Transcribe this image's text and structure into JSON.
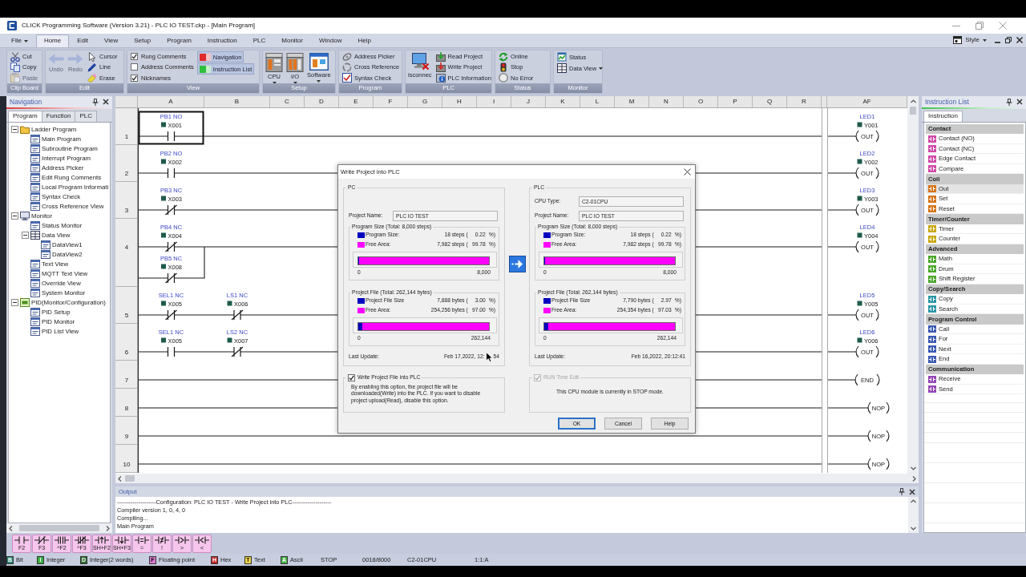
{
  "window": {
    "title": "CLICK Programming Software (Version 3.21) - PLC IO TEST.ckp - [Main Program]"
  },
  "menu": {
    "file": {
      "label": "File"
    },
    "tabs": [
      {
        "label": "Home",
        "selected": true
      },
      {
        "label": "Edit",
        "selected": false
      },
      {
        "label": "View",
        "selected": false
      },
      {
        "label": "Setup",
        "selected": false
      },
      {
        "label": "Program",
        "selected": false
      },
      {
        "label": "Instruction",
        "selected": false
      },
      {
        "label": "PLC",
        "selected": false
      },
      {
        "label": "Monitor",
        "selected": false
      },
      {
        "label": "Window",
        "selected": false
      },
      {
        "label": "Help",
        "selected": false
      }
    ],
    "style": {
      "label": "Style"
    }
  },
  "ribbon": [
    {
      "label": "Clip Board",
      "items": [
        {
          "kind": "small",
          "label": "Cut",
          "disabled": false,
          "caret": false
        },
        {
          "kind": "small",
          "label": "Copy",
          "disabled": false,
          "caret": false
        },
        {
          "kind": "small",
          "label": "Paste",
          "disabled": true,
          "caret": false
        }
      ]
    },
    {
      "label": "Edit",
      "items": [
        {
          "kind": "large",
          "label": "Undo",
          "disabled": true,
          "caret": false
        },
        {
          "kind": "large",
          "label": "Redo",
          "disabled": true,
          "caret": false
        },
        {
          "kind": "small",
          "label": "Cursor",
          "disabled": false,
          "caret": false
        },
        {
          "kind": "small",
          "label": "Line",
          "disabled": false,
          "caret": false
        },
        {
          "kind": "small",
          "label": "Erase",
          "disabled": false,
          "caret": false
        }
      ]
    },
    {
      "label": "View",
      "items": [
        {
          "kind": "check",
          "label": "Rung Comments",
          "checked": true
        },
        {
          "kind": "check",
          "label": "Address Comments",
          "checked": false
        },
        {
          "kind": "check",
          "label": "Nicknames",
          "checked": true
        },
        {
          "kind": "toggle",
          "label": "Navigation",
          "on": true
        },
        {
          "kind": "toggle",
          "label": "Instruction List",
          "on": true
        }
      ]
    },
    {
      "label": "Setup",
      "items": [
        {
          "kind": "large",
          "label": "CPU",
          "disabled": false,
          "caret": true
        },
        {
          "kind": "large",
          "label": "I/O",
          "disabled": false,
          "caret": true
        },
        {
          "kind": "large",
          "label": "Software",
          "disabled": false,
          "caret": true
        }
      ]
    },
    {
      "label": "Program",
      "items": [
        {
          "kind": "small",
          "label": "Address Picker",
          "disabled": false,
          "caret": false
        },
        {
          "kind": "small",
          "label": "Cross Reference",
          "disabled": false,
          "caret": false
        },
        {
          "kind": "small",
          "label": "Syntax Check",
          "disabled": false,
          "caret": false
        }
      ]
    },
    {
      "label": "PLC",
      "items": [
        {
          "kind": "large",
          "label": "isconnec",
          "disabled": false,
          "caret": false
        },
        {
          "kind": "small",
          "label": "Read Project",
          "disabled": false,
          "caret": false
        },
        {
          "kind": "small",
          "label": "Write Project",
          "disabled": false,
          "caret": false
        },
        {
          "kind": "small",
          "label": "PLC Information",
          "disabled": false,
          "caret": false
        }
      ]
    },
    {
      "label": "Status",
      "items": [
        {
          "kind": "small",
          "label": "Online",
          "disabled": false,
          "caret": false
        },
        {
          "kind": "small",
          "label": "Stop",
          "disabled": false,
          "caret": false
        },
        {
          "kind": "small",
          "label": "No Error",
          "disabled": false,
          "caret": false
        }
      ]
    },
    {
      "label": "Monitor",
      "items": [
        {
          "kind": "small",
          "label": "Status",
          "disabled": false,
          "caret": false
        },
        {
          "kind": "small",
          "label": "Data View",
          "disabled": false,
          "caret": true
        }
      ]
    }
  ],
  "navigation": {
    "title": "Navigation",
    "tabs": [
      {
        "label": "Program",
        "selected": true
      },
      {
        "label": "Function",
        "selected": false
      },
      {
        "label": "PLC",
        "selected": false
      }
    ],
    "tree": [
      {
        "label": "Ladder Program",
        "expanded": true,
        "children": [
          {
            "label": "Main Program"
          },
          {
            "label": "Subroutine Program"
          },
          {
            "label": "Interrupt Program"
          },
          {
            "label": "Address Picker"
          },
          {
            "label": "Edit Rung Comments"
          },
          {
            "label": "Local Program Informati"
          },
          {
            "label": "Syntax Check"
          },
          {
            "label": "Cross Reference View"
          }
        ]
      },
      {
        "label": "Monitor",
        "expanded": true,
        "children": [
          {
            "label": "Status Monitor"
          },
          {
            "label": "Data View",
            "expanded": true,
            "children": [
              {
                "label": "DataView1"
              },
              {
                "label": "DataView2"
              }
            ]
          },
          {
            "label": "Text View"
          },
          {
            "label": "MQTT Text View"
          },
          {
            "label": "Override View"
          },
          {
            "label": "System Monitor"
          }
        ]
      },
      {
        "label": "PID(Monitor/Configuration)",
        "expanded": true,
        "children": [
          {
            "label": "PID Setup"
          },
          {
            "label": "PID Monitor"
          },
          {
            "label": "PID List View"
          }
        ]
      }
    ]
  },
  "ladder": {
    "columns": [
      "A",
      "B",
      "C",
      "D",
      "E",
      "F",
      "G",
      "H",
      "I",
      "J",
      "K",
      "L",
      "M",
      "N",
      "O",
      "P",
      "Q",
      "R",
      "AF"
    ],
    "rungs": [
      {
        "number": "1",
        "contacts": [
          {
            "kind": "no",
            "nickname": "PB1 NO",
            "address": "X001",
            "selected": true
          }
        ],
        "coil": {
          "kind": "out",
          "nickname": "LED1",
          "address": "Y001",
          "label": "OUT"
        }
      },
      {
        "number": "2",
        "contacts": [
          {
            "kind": "no",
            "nickname": "PB2 NO",
            "address": "X002",
            "selected": false
          }
        ],
        "coil": {
          "kind": "out",
          "nickname": "LED2",
          "address": "Y002",
          "label": "OUT"
        }
      },
      {
        "number": "3",
        "contacts": [
          {
            "kind": "nc",
            "nickname": "PB3 NC",
            "address": "X003",
            "selected": false
          }
        ],
        "coil": {
          "kind": "out",
          "nickname": "LED3",
          "address": "Y003",
          "label": "OUT"
        }
      },
      {
        "number": "4",
        "contacts": [
          {
            "kind": "nc",
            "nickname": "PB4 NC",
            "address": "X004",
            "selected": false,
            "parallel": {
              "kind": "nc",
              "nickname": "PB5 NC",
              "address": "X008",
              "selected": false
            }
          }
        ],
        "coil": {
          "kind": "out",
          "nickname": "LED4",
          "address": "Y004",
          "label": "OUT"
        }
      },
      {
        "number": "5",
        "contacts": [
          {
            "kind": "nc",
            "nickname": "SEL1 NC",
            "address": "X005",
            "selected": false
          },
          {
            "kind": "nc",
            "nickname": "LS1 NC",
            "address": "X006",
            "selected": false
          }
        ],
        "coil": {
          "kind": "out",
          "nickname": "LED5",
          "address": "Y005",
          "label": "OUT"
        }
      },
      {
        "number": "6",
        "contacts": [
          {
            "kind": "no",
            "nickname": "SEL1 NC",
            "address": "X005",
            "selected": false
          },
          {
            "kind": "nc",
            "nickname": "LS2 NC",
            "address": "X007",
            "selected": false
          }
        ],
        "coil": {
          "kind": "out",
          "nickname": "LED6",
          "address": "Y006",
          "label": "OUT"
        }
      },
      {
        "number": "7",
        "coil": {
          "kind": "end",
          "label": "END"
        }
      },
      {
        "number": "8",
        "coil": {
          "kind": "nop",
          "label": "NOP"
        }
      },
      {
        "number": "9",
        "coil": {
          "kind": "nop",
          "label": "NOP"
        }
      },
      {
        "number": "10",
        "coil": {
          "kind": "nop",
          "label": "NOP"
        }
      }
    ]
  },
  "dialog": {
    "title": "Write Project into PLC",
    "pc": {
      "legend": "PC",
      "project_name_label": "Project Name:",
      "project_name": "PLC IO TEST",
      "program_size": {
        "legend": "Program Size (Total: 8,000 steps)",
        "rows": [
          {
            "label": "Program Size:",
            "amount": "18 steps (",
            "percent": "0.22",
            "unit": "%)",
            "color": "#0000c0"
          },
          {
            "label": "Free Area:",
            "amount": "7,982 steps (",
            "percent": "99.78",
            "unit": "%)",
            "color": "#ff00ff"
          }
        ],
        "level": 0.00225,
        "scale": [
          "0",
          "8,000"
        ]
      },
      "project_file": {
        "legend": "Project File (Total: 262,144 bytes)",
        "rows": [
          {
            "label": "Project File Size",
            "amount": "7,888 bytes (",
            "percent": "3.00",
            "unit": "%)",
            "color": "#0000c0"
          },
          {
            "label": "Free Area:",
            "amount": "254,256 bytes (",
            "percent": "97.00",
            "unit": "%)",
            "color": "#ff00ff"
          }
        ],
        "level": 0.03,
        "scale": [
          "0",
          "262,144"
        ]
      },
      "last_update_label": "Last Update:",
      "last_update": [
        "Feb 17,2022, 12:",
        "54"
      ]
    },
    "plc": {
      "legend": "PLC",
      "cpu_type_label": "CPU Type:",
      "cpu_type": "C2-01CPU",
      "project_name_label": "Project Name:",
      "project_name": "PLC IO TEST",
      "program_size": {
        "legend": "Program Size (Total: 8,000 steps)",
        "rows": [
          {
            "label": "Program Size:",
            "amount": "18 steps (",
            "percent": "0.22",
            "unit": "%)",
            "color": "#0000c0"
          },
          {
            "label": "Free Area:",
            "amount": "7,982 steps (",
            "percent": "99.78",
            "unit": "%)",
            "color": "#ff00ff"
          }
        ],
        "level": 0.00225,
        "scale": [
          "0",
          "8,000"
        ]
      },
      "project_file": {
        "legend": "Project File (Total: 262,144 bytes)",
        "rows": [
          {
            "label": "Project File Size",
            "amount": "7,790 bytes (",
            "percent": "2.97",
            "unit": "%)",
            "color": "#0000c0"
          },
          {
            "label": "Free Area:",
            "amount": "254,354 bytes (",
            "percent": "97.03",
            "unit": "%)",
            "color": "#ff00ff"
          }
        ],
        "level": 0.0297,
        "scale": [
          "0",
          "262,144"
        ]
      },
      "last_update_label": "Last Update:",
      "last_update": [
        "Feb 16,2022, 20:12:41"
      ]
    },
    "write_file": {
      "label": "Write Project File into PLC",
      "checked": true,
      "description": "By enabling this option, the project file will be downloaded(Write) into the PLC. If you want to disable project upload(Read), disable this option."
    },
    "run_time_edit": {
      "label": "RUN Time Edit",
      "checked": true,
      "disabled": true,
      "message": "This CPU module is currently in STOP mode."
    },
    "buttons": [
      {
        "label": "OK",
        "default": true
      },
      {
        "label": "Cancel",
        "default": false
      },
      {
        "label": "Help",
        "default": false
      }
    ]
  },
  "instruction_list": {
    "title": "Instruction List",
    "tabs": [
      {
        "label": "Instruction",
        "selected": true
      }
    ],
    "categories": [
      {
        "label": "Contact",
        "color": "#d04aa8",
        "items": [
          {
            "label": "Contact (NO)",
            "selected": false
          },
          {
            "label": "Contact (NC)",
            "selected": false
          },
          {
            "label": "Edge Contact",
            "selected": false
          },
          {
            "label": "Compare",
            "selected": false
          }
        ]
      },
      {
        "label": "Coil",
        "color": "#d5741a",
        "items": [
          {
            "label": "Out",
            "selected": true
          },
          {
            "label": "Set",
            "selected": false
          },
          {
            "label": "Reset",
            "selected": false
          }
        ]
      },
      {
        "label": "Timer/Counter",
        "color": "#c9a80c",
        "items": [
          {
            "label": "Timer",
            "selected": false
          },
          {
            "label": "Counter",
            "selected": false
          }
        ]
      },
      {
        "label": "Advanced",
        "color": "#4aa62a",
        "items": [
          {
            "label": "Math",
            "selected": false
          },
          {
            "label": "Drum",
            "selected": false
          },
          {
            "label": "Shift Register",
            "selected": false
          }
        ]
      },
      {
        "label": "Copy/Search",
        "color": "#2a96a8",
        "items": [
          {
            "label": "Copy",
            "selected": false
          },
          {
            "label": "Search",
            "selected": false
          }
        ]
      },
      {
        "label": "Program Control",
        "color": "#3a58b4",
        "items": [
          {
            "label": "Call",
            "selected": false
          },
          {
            "label": "For",
            "selected": false
          },
          {
            "label": "Next",
            "selected": false
          },
          {
            "label": "End",
            "selected": false
          }
        ]
      },
      {
        "label": "Communication",
        "color": "#9446b4",
        "items": [
          {
            "label": "Receive",
            "selected": false
          },
          {
            "label": "Send",
            "selected": false
          }
        ]
      }
    ]
  },
  "output": {
    "title": "Output",
    "lines": [
      "--------------------Configuration: PLC IO TEST - Write Project into PLC--------------------",
      "Compiler version 1, 0, 4, 0",
      "Compiling...",
      "Main Program"
    ]
  },
  "instruction_buttons": [
    {
      "kind": "no",
      "key": "F2"
    },
    {
      "kind": "nc",
      "key": "F3"
    },
    {
      "kind": "no_immediate",
      "key": "^F2"
    },
    {
      "kind": "nc_immediate",
      "key": "^F3"
    },
    {
      "kind": "rising",
      "key": "SH+F2"
    },
    {
      "kind": "falling",
      "key": "SH+F3"
    },
    {
      "kind": "equal",
      "key": "="
    },
    {
      "kind": "not_equal",
      "key": "!"
    },
    {
      "kind": "greater",
      "key": ">"
    },
    {
      "kind": "less",
      "key": "<"
    }
  ],
  "status_bar": {
    "data_types": [
      {
        "letter": "B",
        "label": "Bit",
        "color": "#2a8a78"
      },
      {
        "letter": "I",
        "label": "Integer",
        "color": "#3cb043"
      },
      {
        "letter": "D",
        "label": "Integer(2 words)",
        "color": "#2f6e2f"
      },
      {
        "letter": "F",
        "label": "Floating point",
        "color": "#e07ad6"
      },
      {
        "letter": "H",
        "label": "Hex",
        "color": "#c62424"
      },
      {
        "letter": "T",
        "label": "Text",
        "color": "#ecd54a"
      },
      {
        "letter": "A",
        "label": "Ascii",
        "color": "#46b646"
      }
    ],
    "fields": [
      "STOP",
      "0018/8000",
      "C2-01CPU",
      "1:1:A"
    ]
  }
}
